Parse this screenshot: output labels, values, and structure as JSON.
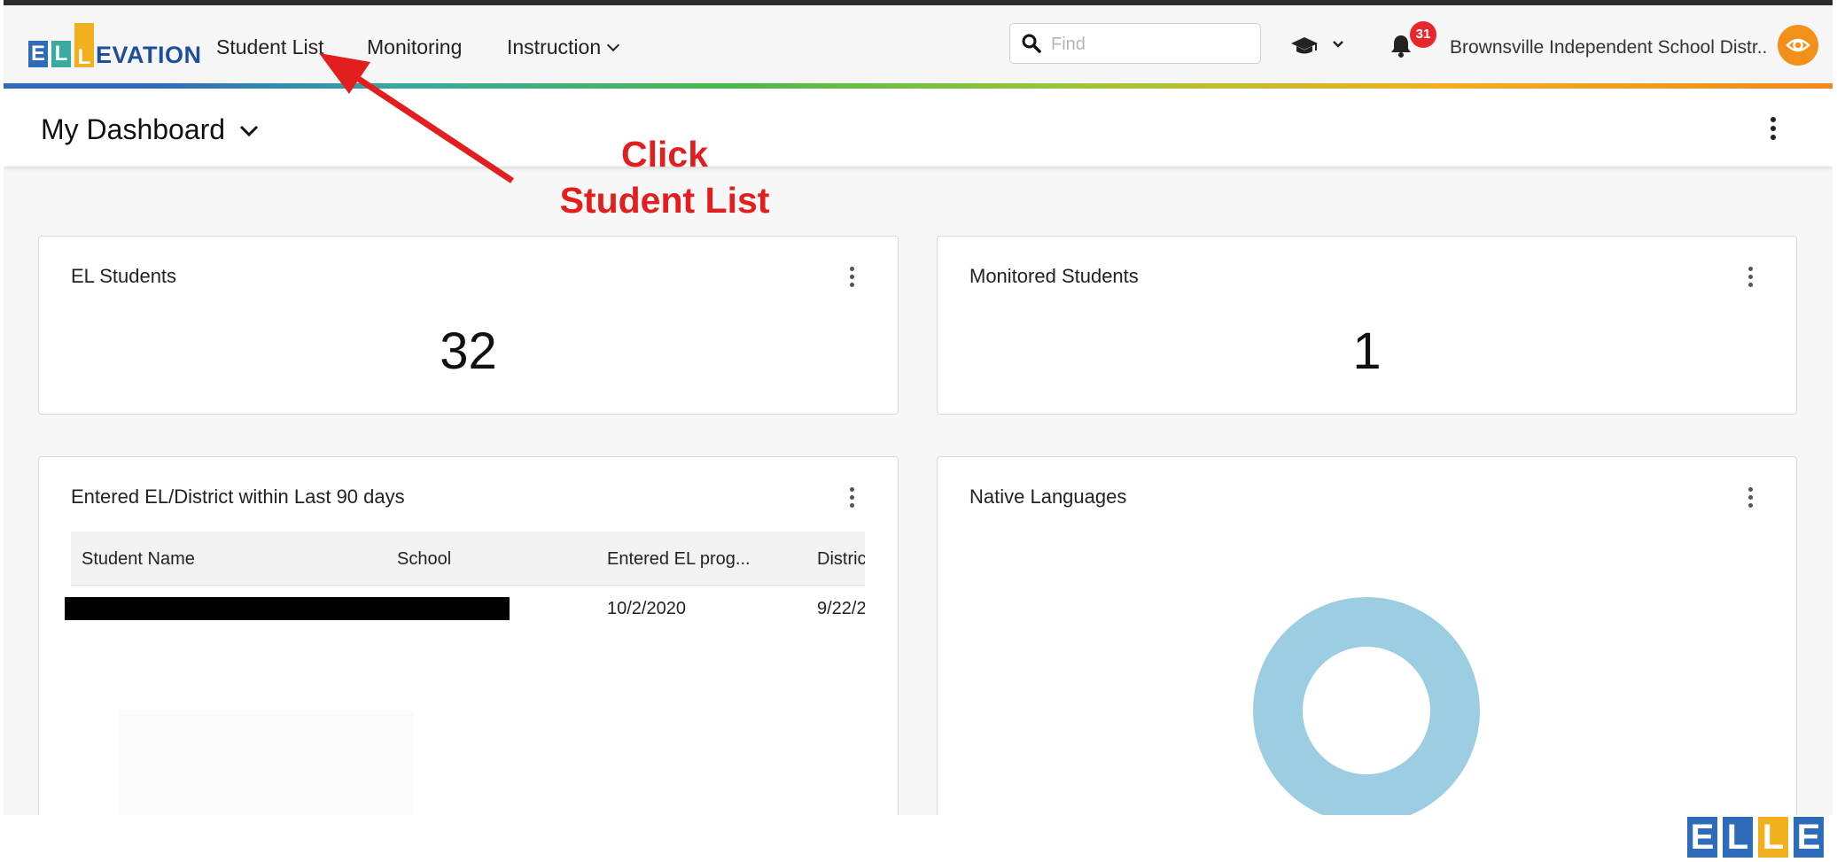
{
  "nav": {
    "logo_text": "ELLEVATION",
    "links": [
      {
        "label": "Student List"
      },
      {
        "label": "Monitoring"
      },
      {
        "label": "Instruction"
      }
    ],
    "search_placeholder": "Find",
    "notification_count": "31",
    "district_name": "Brownsville Independent School Distr...",
    "icons": [
      "search-icon",
      "graduation-cap-icon",
      "chevron-down-icon",
      "bell-icon",
      "eye-icon"
    ]
  },
  "header": {
    "title": "My Dashboard"
  },
  "annotation": {
    "line1": "Click",
    "line2": "Student List",
    "color": "#e21e1e"
  },
  "cards": {
    "el_students": {
      "title": "EL Students",
      "value": "32"
    },
    "monitored_students": {
      "title": "Monitored Students",
      "value": "1"
    },
    "entered": {
      "title": "Entered EL/District within Last 90 days",
      "columns": [
        "Student Name",
        "School",
        "Entered EL prog...",
        "Distric"
      ],
      "rows": [
        {
          "entered_el": "10/2/2020",
          "district": "9/22/2"
        }
      ]
    },
    "native_languages": {
      "title": "Native Languages"
    }
  },
  "colors": {
    "brand_blue": "#2e6bb8",
    "brand_orange": "#f39019",
    "donut": "#9ccde3",
    "badge": "#e8262c"
  }
}
